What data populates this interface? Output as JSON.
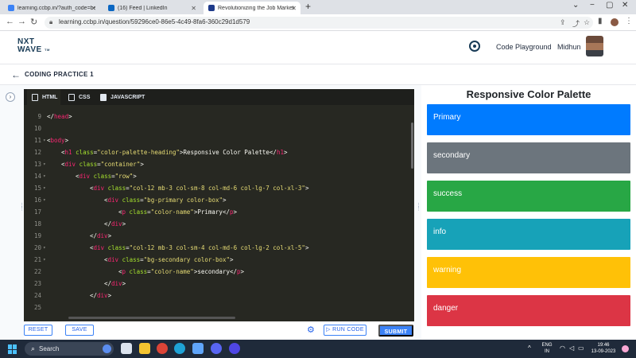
{
  "browser": {
    "tabs": [
      {
        "title": "learning.ccbp.in/?auth_code=be",
        "color": "#3b82f6"
      },
      {
        "title": "(16) Feed | LinkedIn",
        "color": "#0a66c2"
      },
      {
        "title": "Revolutionizing the Job Market |",
        "color": "#1e3a8a"
      }
    ],
    "url": "learning.ccbp.in/question/59296ce0-86e5-4c49-8fa6-360c29d1d579"
  },
  "header": {
    "logo_line1": "NXT",
    "logo_line2": "WAVE",
    "logo_tm": "TM",
    "playground_label": "Code Playground",
    "user_name": "Midhun"
  },
  "question": {
    "title": "CODING PRACTICE 1"
  },
  "editor": {
    "tabs": [
      {
        "label": "HTML",
        "icon_color": "#e2e8f0"
      },
      {
        "label": "CSS",
        "icon_color": "#e2e8f0"
      },
      {
        "label": "JAVASCRIPT",
        "icon_color": "#e2e8f0"
      }
    ],
    "lines": [
      {
        "num": "9",
        "fold": "",
        "indent": 0,
        "parts": [
          [
            "t",
            "</"
          ],
          [
            "tag",
            "head"
          ],
          [
            "t",
            ">"
          ]
        ]
      },
      {
        "num": "10",
        "fold": "",
        "indent": 0,
        "parts": []
      },
      {
        "num": "11",
        "fold": "▾",
        "indent": 0,
        "parts": [
          [
            "t",
            "<"
          ],
          [
            "tag",
            "body"
          ],
          [
            "t",
            ">"
          ]
        ]
      },
      {
        "num": "12",
        "fold": "",
        "indent": 1,
        "parts": [
          [
            "t",
            "<"
          ],
          [
            "tag",
            "h1"
          ],
          [
            "t",
            " "
          ],
          [
            "attr",
            "class"
          ],
          [
            "t",
            "="
          ],
          [
            "str",
            "\"color-palette-heading\""
          ],
          [
            "t",
            ">Responsive Color Palette</"
          ],
          [
            "tag",
            "h1"
          ],
          [
            "t",
            ">"
          ]
        ]
      },
      {
        "num": "13",
        "fold": "▾",
        "indent": 1,
        "parts": [
          [
            "t",
            "<"
          ],
          [
            "tag",
            "div"
          ],
          [
            "t",
            " "
          ],
          [
            "attr",
            "class"
          ],
          [
            "t",
            "="
          ],
          [
            "str",
            "\"container\""
          ],
          [
            "t",
            ">"
          ]
        ]
      },
      {
        "num": "14",
        "fold": "▾",
        "indent": 2,
        "parts": [
          [
            "t",
            "<"
          ],
          [
            "tag",
            "div"
          ],
          [
            "t",
            " "
          ],
          [
            "attr",
            "class"
          ],
          [
            "t",
            "="
          ],
          [
            "str",
            "\"row\""
          ],
          [
            "t",
            ">"
          ]
        ]
      },
      {
        "num": "15",
        "fold": "▾",
        "indent": 3,
        "parts": [
          [
            "t",
            "<"
          ],
          [
            "tag",
            "div"
          ],
          [
            "t",
            " "
          ],
          [
            "attr",
            "class"
          ],
          [
            "t",
            "="
          ],
          [
            "str",
            "\"col-12 mb-3 col-sm-8 col-md-6 col-lg-7 col-xl-3\""
          ],
          [
            "t",
            ">"
          ]
        ]
      },
      {
        "num": "16",
        "fold": "▾",
        "indent": 4,
        "parts": [
          [
            "t",
            "<"
          ],
          [
            "tag",
            "div"
          ],
          [
            "t",
            " "
          ],
          [
            "attr",
            "class"
          ],
          [
            "t",
            "="
          ],
          [
            "str",
            "\"bg-primary color-box\""
          ],
          [
            "t",
            ">"
          ]
        ]
      },
      {
        "num": "17",
        "fold": "",
        "indent": 5,
        "parts": [
          [
            "t",
            "<"
          ],
          [
            "tag",
            "p"
          ],
          [
            "t",
            " "
          ],
          [
            "attr",
            "class"
          ],
          [
            "t",
            "="
          ],
          [
            "str",
            "\"color-name\""
          ],
          [
            "t",
            ">Primary</"
          ],
          [
            "tag",
            "p"
          ],
          [
            "t",
            ">"
          ]
        ]
      },
      {
        "num": "18",
        "fold": "",
        "indent": 4,
        "parts": [
          [
            "t",
            "</"
          ],
          [
            "tag",
            "div"
          ],
          [
            "t",
            ">"
          ]
        ]
      },
      {
        "num": "19",
        "fold": "",
        "indent": 3,
        "parts": [
          [
            "t",
            "</"
          ],
          [
            "tag",
            "div"
          ],
          [
            "t",
            ">"
          ]
        ]
      },
      {
        "num": "20",
        "fold": "▾",
        "indent": 3,
        "parts": [
          [
            "t",
            "<"
          ],
          [
            "tag",
            "div"
          ],
          [
            "t",
            " "
          ],
          [
            "attr",
            "class"
          ],
          [
            "t",
            "="
          ],
          [
            "str",
            "\"col-12 mb-3 col-sm-4 col-md-6 col-lg-2 col-xl-5\""
          ],
          [
            "t",
            ">"
          ]
        ]
      },
      {
        "num": "21",
        "fold": "▾",
        "indent": 4,
        "parts": [
          [
            "t",
            "<"
          ],
          [
            "tag",
            "div"
          ],
          [
            "t",
            " "
          ],
          [
            "attr",
            "class"
          ],
          [
            "t",
            "="
          ],
          [
            "str",
            "\"bg-secondary color-box\""
          ],
          [
            "t",
            ">"
          ]
        ]
      },
      {
        "num": "22",
        "fold": "",
        "indent": 5,
        "parts": [
          [
            "t",
            "<"
          ],
          [
            "tag",
            "p"
          ],
          [
            "t",
            " "
          ],
          [
            "attr",
            "class"
          ],
          [
            "t",
            "="
          ],
          [
            "str",
            "\"color-name\""
          ],
          [
            "t",
            ">secondary</"
          ],
          [
            "tag",
            "p"
          ],
          [
            "t",
            ">"
          ]
        ]
      },
      {
        "num": "23",
        "fold": "",
        "indent": 4,
        "parts": [
          [
            "t",
            "</"
          ],
          [
            "tag",
            "div"
          ],
          [
            "t",
            ">"
          ]
        ]
      },
      {
        "num": "24",
        "fold": "",
        "indent": 3,
        "parts": [
          [
            "t",
            "</"
          ],
          [
            "tag",
            "div"
          ],
          [
            "t",
            ">"
          ]
        ]
      },
      {
        "num": "25",
        "fold": "",
        "indent": 0,
        "parts": []
      }
    ]
  },
  "actions": {
    "reset_label": "RESET",
    "save_label": "SAVE",
    "run_label": "RUN CODE",
    "submit_label": "SUBMIT"
  },
  "preview": {
    "heading": "Responsive Color Palette",
    "boxes": [
      {
        "label": "Primary",
        "color": "#007bff"
      },
      {
        "label": "secondary",
        "color": "#6c757d"
      },
      {
        "label": "success",
        "color": "#28a745"
      },
      {
        "label": "info",
        "color": "#17a2b8"
      },
      {
        "label": "warning",
        "color": "#ffc107"
      },
      {
        "label": "danger",
        "color": "#dc3545"
      }
    ]
  },
  "taskbar": {
    "search_label": "Search",
    "lang_line1": "ENG",
    "lang_line2": "IN",
    "time": "19:46",
    "date": "13-09-2023"
  }
}
